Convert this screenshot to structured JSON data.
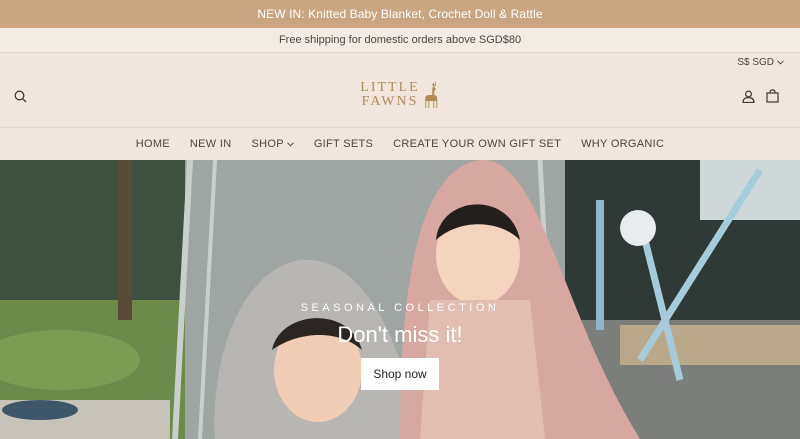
{
  "announcement": {
    "text": "NEW IN: Knitted Baby Blanket, Crochet Doll & Rattle"
  },
  "shipping": {
    "text": "Free shipping for domestic orders above SGD$80"
  },
  "header": {
    "currency": "S$ SGD",
    "logo_line1": "LITTLE",
    "logo_line2": "FAWNS",
    "icons": [
      "search-icon",
      "fawn-logo-icon",
      "account-icon",
      "cart-icon"
    ]
  },
  "nav": {
    "items": [
      {
        "label": "HOME"
      },
      {
        "label": "NEW IN"
      },
      {
        "label": "SHOP",
        "has_dropdown": true
      },
      {
        "label": "GIFT SETS"
      },
      {
        "label": "CREATE YOUR OWN GIFT SET"
      },
      {
        "label": "WHY ORGANIC"
      }
    ]
  },
  "hero": {
    "eyebrow": "SEASONAL COLLECTION",
    "title": "Don't miss it!",
    "cta": "Shop now"
  },
  "colors": {
    "announcement_bg": "#cba57f",
    "header_bg": "#f0e6dd",
    "logo_gold": "#b08d57",
    "text": "#4a4540"
  }
}
